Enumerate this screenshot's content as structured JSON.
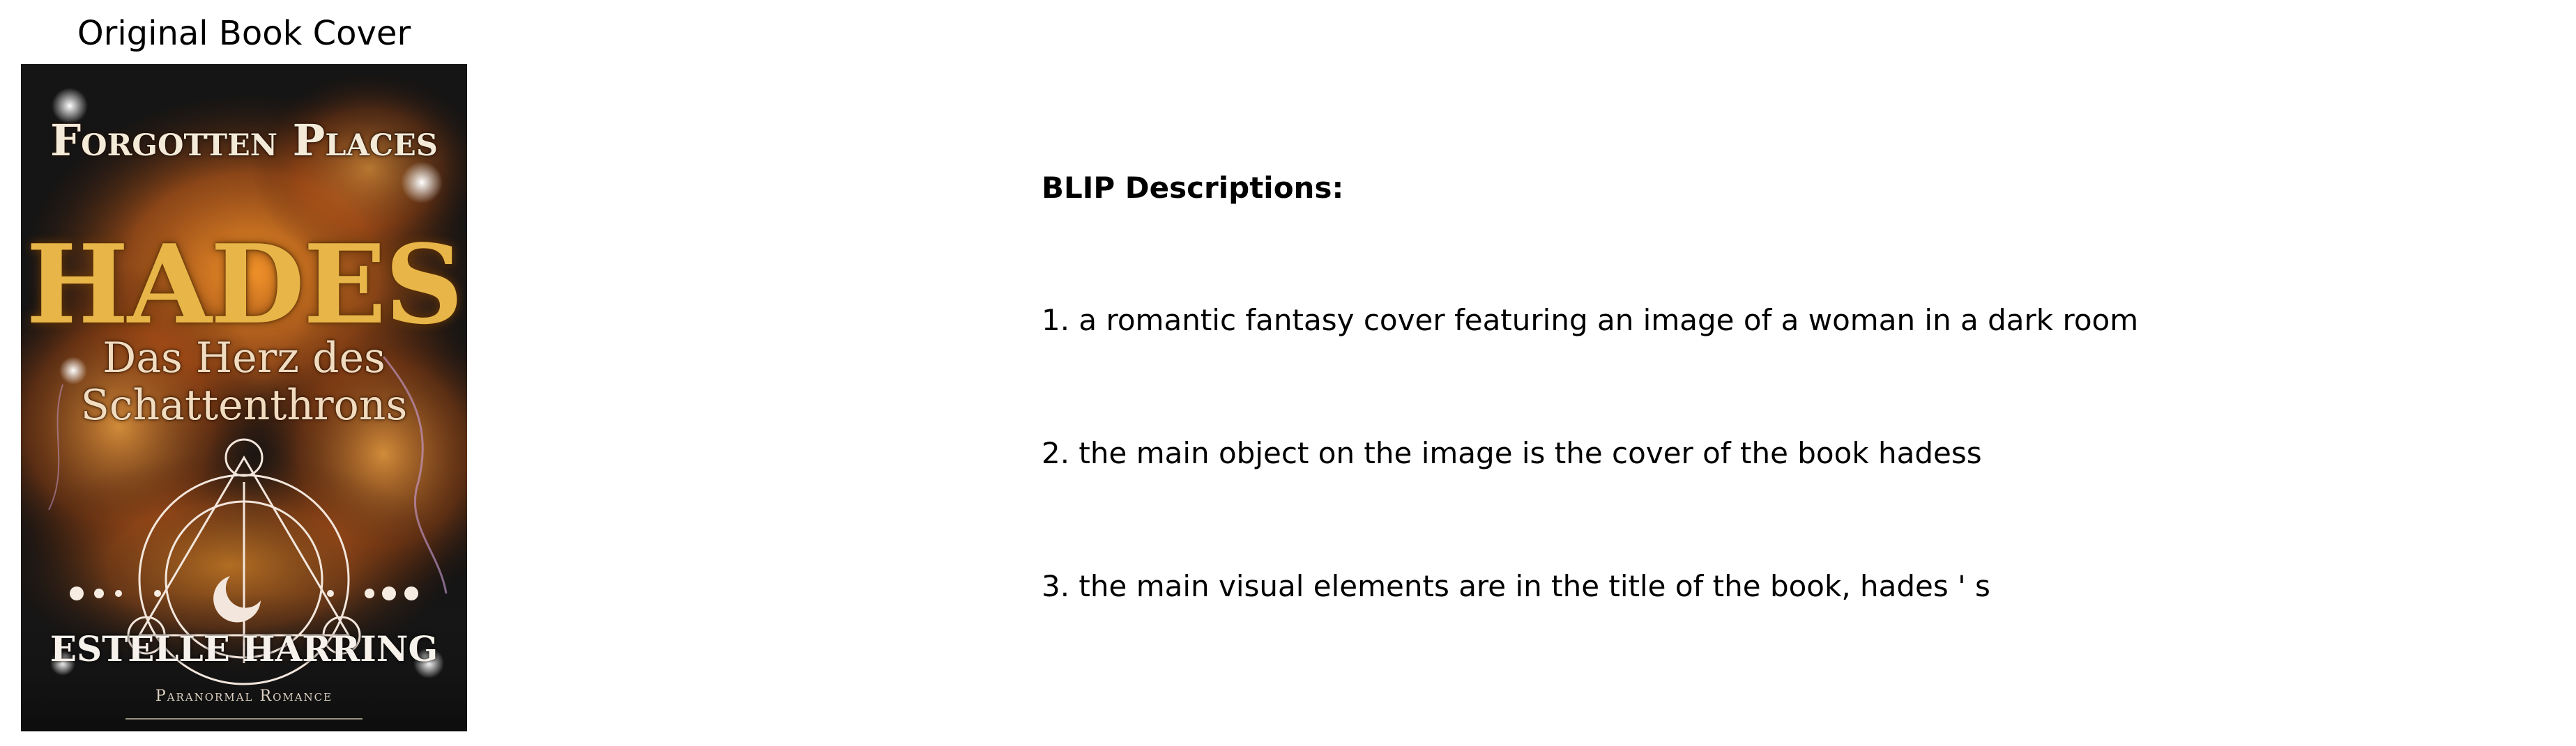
{
  "figure": {
    "cover_panel_title": "Original Book Cover",
    "descriptions_heading": "BLIP Descriptions:",
    "descriptions": [
      "1. a romantic fantasy cover featuring an image of a woman in a dark room",
      "2. the main object on the image is the cover of the book hadess",
      "3. the main visual elements are in the title of the book, hades ' s"
    ]
  },
  "cover": {
    "series": "Forgotten Places",
    "title": "HADES",
    "subtitle_line1": "Das Herz des",
    "subtitle_line2": "Schattenthrons",
    "author": "ESTELLE HARRING",
    "genre": "Paranormal Romance",
    "colors": {
      "background": "#151515",
      "smoke": "#e0741c",
      "title_gold": "#e8b648",
      "symbol": "#f3e6dc"
    }
  }
}
